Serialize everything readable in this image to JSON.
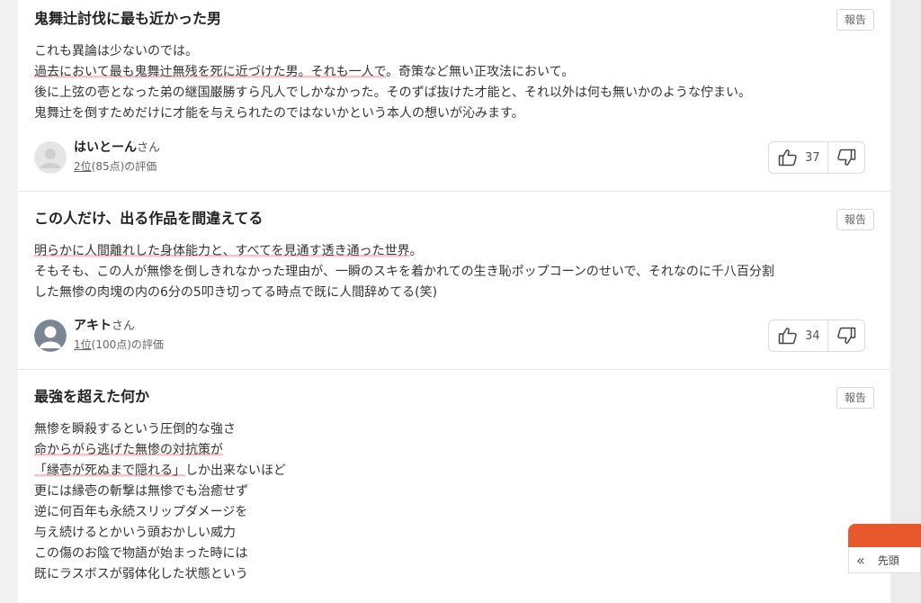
{
  "reviews": [
    {
      "title": "鬼舞辻討伐に最も近かった男",
      "report_label": "報告",
      "lines": [
        [
          {
            "t": "これも異論は少ないのでは。",
            "hl": false
          }
        ],
        [
          {
            "t": "過去において最も鬼舞辻無残を死に近づけた男。それも一人で",
            "hl": true
          },
          {
            "t": "。奇策など無い正攻法において。",
            "hl": false
          }
        ],
        [
          {
            "t": "後に上弦の壱となった弟の継国巌勝すら凡人でしかなかった。そのずば抜けた才能と、それ以外は何も無いかのような佇まい。",
            "hl": false
          }
        ],
        [
          {
            "t": "鬼舞辻を倒すためだけに才能を与えられたのではないかという本人の想いが沁みます。",
            "hl": false
          }
        ]
      ],
      "user": {
        "name": "はいとーん",
        "honorific": "さん",
        "rank_link": "2位",
        "rank_rest": "(85点)の評価",
        "avatar": "default-avatar-icon"
      },
      "likes": "37"
    },
    {
      "title": "この人だけ、出る作品を間違えてる",
      "report_label": "報告",
      "lines": [
        [
          {
            "t": "明らかに人間離れした身体能力と、すべてを見通す透き通った世界",
            "hl": true
          },
          {
            "t": "。",
            "hl": false
          }
        ],
        [
          {
            "t": "そもそも、この人が無惨を倒しきれなかった理由が、一瞬のスキを着かれての生き恥ポップコーンのせいで、それなのに千八百分割",
            "hl": false
          }
        ],
        [
          {
            "t": "した無惨の肉塊の内の6分の5叩き切ってる時点で既に人間辞めてる(笑)",
            "hl": false
          }
        ]
      ],
      "user": {
        "name": "アキト",
        "honorific": "さん",
        "rank_link": "1位",
        "rank_rest": "(100点)の評価",
        "avatar": "user-silhouette-icon"
      },
      "likes": "34"
    },
    {
      "title": "最強を超えた何か",
      "report_label": "報告",
      "lines": [
        [
          {
            "t": "無惨を瞬殺するという圧倒的な強さ",
            "hl": false
          }
        ],
        [
          {
            "t": "命からがら逃げた無惨の対抗策が",
            "hl": true
          }
        ],
        [
          {
            "t": "「縁壱が死ぬまで隠れる」",
            "hl": true
          },
          {
            "t": "しか出来ないほど",
            "hl": false
          }
        ],
        [
          {
            "t": "更には縁壱の斬撃は無惨でも治癒せず",
            "hl": false
          }
        ],
        [
          {
            "t": "逆に何百年も永続スリップダメージを",
            "hl": false
          }
        ],
        [
          {
            "t": "与え続けるとかいう頭おかしい威力",
            "hl": false
          }
        ],
        [
          {
            "t": "この傷のお陰で物語が始まった時には",
            "hl": false
          }
        ],
        [
          {
            "t": "既にラスボスが弱体化した状態という",
            "hl": false
          }
        ]
      ]
    }
  ],
  "float": {
    "label": "先頭",
    "icon": "double-chevron-left-icon"
  },
  "colors": {
    "highlight": "#f7c3cb",
    "accent": "#e8582f"
  }
}
